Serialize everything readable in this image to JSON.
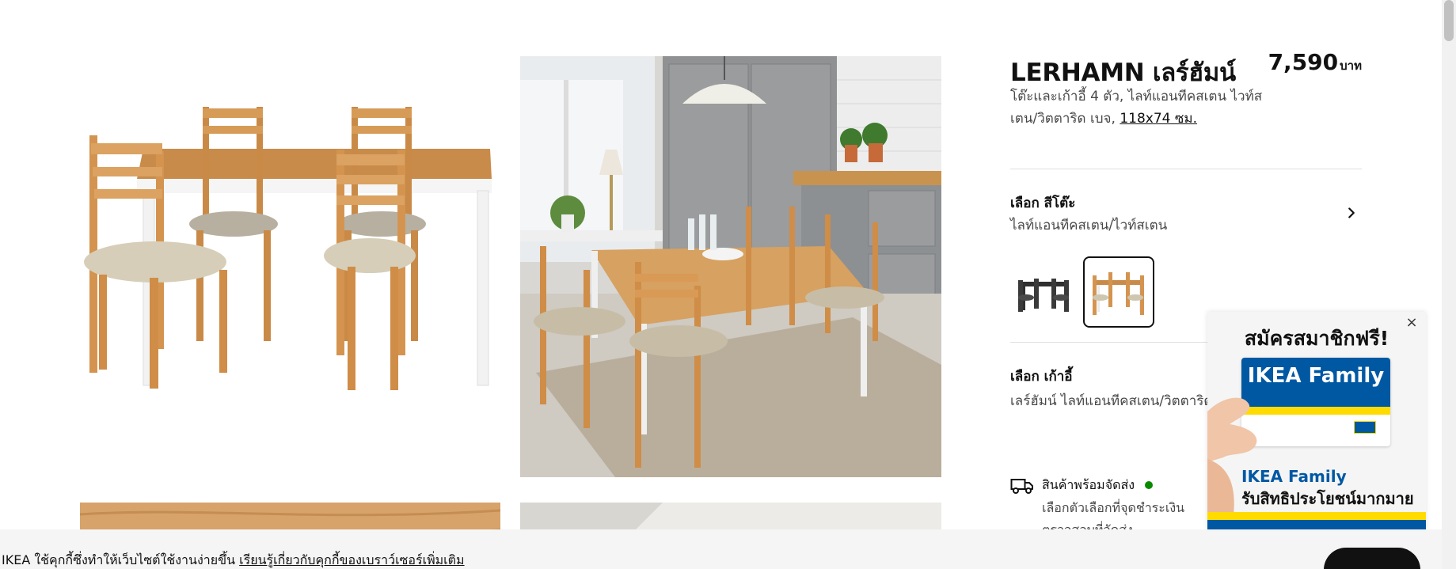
{
  "product": {
    "name": "LERHAMN เลร์ฮัมน์",
    "price_amount": "7,590",
    "price_currency": "บาท",
    "description": "โต๊ะและเก้าอี้ 4 ตัว, ไลท์แอนทีคสเตน ไวท์สเตน/วิตตาริด เบจ,",
    "size_link": "118x74 ซม."
  },
  "table_color": {
    "label": "เลือก สีโต๊ะ",
    "value": "ไลท์แอนทีคสเตน/ไวท์สเตน",
    "swatches": [
      {
        "name": "dark",
        "selected": false
      },
      {
        "name": "light-antique",
        "selected": true
      }
    ]
  },
  "chair": {
    "label": "เลือก เก้าอี้",
    "value": "เลร์ฮัมน์ ไลท์แอนทีคสเตน/วิตตาริด เบจ"
  },
  "delivery": {
    "status": "สินค้าพร้อมจัดส่ง",
    "note": "เลือกตัวเลือกที่จุดชำระเงิน",
    "note2": "ตรวจสอบที่จัดส่ง"
  },
  "popup": {
    "headline": "สมัครสมาชิกฟรี!",
    "card_text": "IKEA Family",
    "family_text": "IKEA Family",
    "benefit_text": "รับสิทธิประโยชน์มากมาย",
    "close": "×"
  },
  "cookie": {
    "text": "IKEA ใช้คุกกี้ซึ่งทำให้เว็บไซต์ใช้งานง่ายขึ้น",
    "link": "เรียนรู้เกี่ยวกับคุกกี้ของเบราว์เซอร์เพิ่มเติม",
    "button": ""
  },
  "icons": {
    "chevron": "chevron-right-icon",
    "truck": "truck-icon",
    "close": "close-icon"
  },
  "colors": {
    "available_green": "#0a8a00",
    "ikea_blue": "#0058a3",
    "ikea_yellow": "#ffdb00",
    "pine": "#d39a57",
    "seat_beige": "#cfc6b0"
  }
}
